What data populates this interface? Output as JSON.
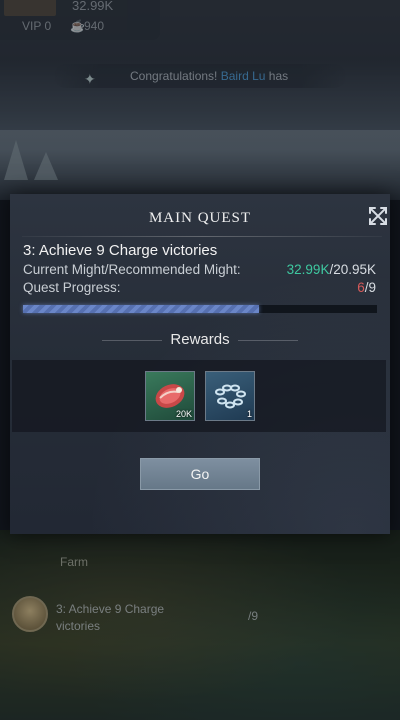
{
  "hud": {
    "might": "32.99K",
    "vip": "VIP 0",
    "power": "940"
  },
  "ticker": {
    "prefix": "Congratulations!",
    "name": "Baird Lu",
    "suffix": "has"
  },
  "modal": {
    "title": "MAIN QUEST",
    "quest_name": "3: Achieve 9 Charge victories",
    "might_label": "Current Might/Recommended Might:",
    "might_current": "32.99K",
    "might_recommended": "/20.95K",
    "progress_label": "Quest Progress:",
    "progress_done": "6",
    "progress_total": "/9",
    "progress_fraction": 0.667,
    "rewards_heading": "Rewards",
    "rewards": [
      {
        "icon": "meat-icon",
        "count": "20K"
      },
      {
        "icon": "chain-icon",
        "count": "1"
      }
    ],
    "go_label": "Go"
  },
  "tracker": {
    "farm_label": "Farm",
    "quest_text": "3: Achieve 9 Charge victories",
    "progress": "/9"
  },
  "colors": {
    "might_current": "#3ec8a0",
    "progress_done": "#d65a5a",
    "progress_bar": "#6a86c8"
  }
}
